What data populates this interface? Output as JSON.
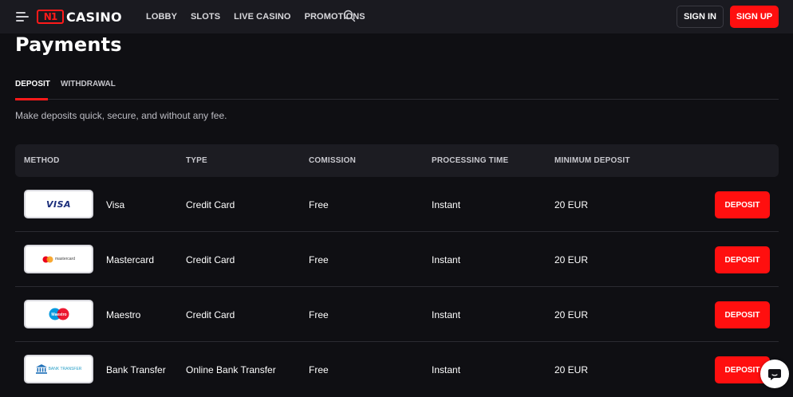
{
  "header": {
    "logo_mark": "N1",
    "logo_text": "CASINO",
    "nav": [
      "LOBBY",
      "SLOTS",
      "LIVE CASINO",
      "PROMOTIONS"
    ],
    "sign_in": "SIGN IN",
    "sign_up": "SIGN UP"
  },
  "page": {
    "title": "Payments",
    "tabs": [
      {
        "label": "DEPOSIT",
        "active": true
      },
      {
        "label": "WITHDRAWAL",
        "active": false
      }
    ],
    "subtitle": "Make deposits quick, secure, and without any fee."
  },
  "table": {
    "columns": [
      "METHOD",
      "TYPE",
      "COMISSION",
      "PROCESSING TIME",
      "MINIMUM DEPOSIT"
    ],
    "rows": [
      {
        "logo": "visa",
        "logo_text": "VISA",
        "method": "Visa",
        "type": "Credit Card",
        "commission": "Free",
        "time": "Instant",
        "min": "20 EUR",
        "action": "DEPOSIT"
      },
      {
        "logo": "mastercard",
        "logo_text": "mastercard",
        "method": "Mastercard",
        "type": "Credit Card",
        "commission": "Free",
        "time": "Instant",
        "min": "20 EUR",
        "action": "DEPOSIT"
      },
      {
        "logo": "maestro",
        "logo_text": "Maestro",
        "method": "Maestro",
        "type": "Credit Card",
        "commission": "Free",
        "time": "Instant",
        "min": "20 EUR",
        "action": "DEPOSIT"
      },
      {
        "logo": "bank",
        "logo_text": "BANK TRANSFER",
        "method": "Bank Transfer",
        "type": "Online Bank Transfer",
        "commission": "Free",
        "time": "Instant",
        "min": "20 EUR",
        "action": "DEPOSIT"
      }
    ]
  },
  "icons": {
    "menu": "hamburger-menu-icon",
    "search": "search-icon",
    "chat": "chat-bubble-icon"
  },
  "colors": {
    "accent": "#ff0f0f",
    "background": "#0f0f13",
    "header": "#1a1a20",
    "table_head": "#1c1c22"
  }
}
